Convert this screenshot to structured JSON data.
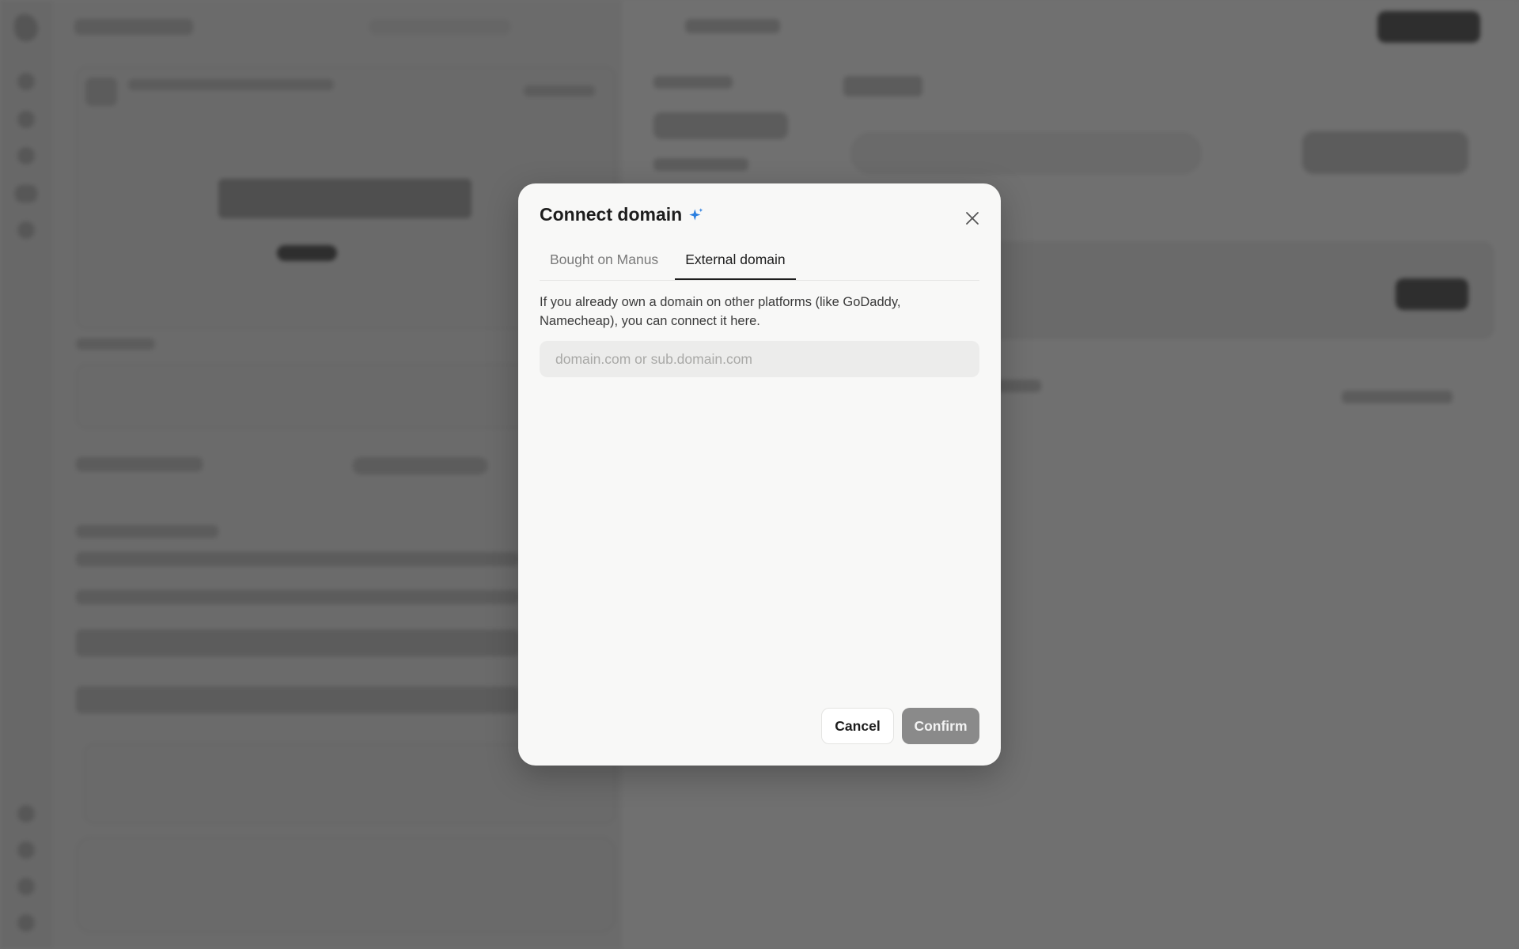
{
  "modal": {
    "title": "Connect domain",
    "tabs": [
      {
        "label": "Bought on Manus",
        "active": false
      },
      {
        "label": "External domain",
        "active": true
      }
    ],
    "description": "If you already own a domain on other platforms (like GoDaddy, Namecheap), you can connect it here.",
    "input": {
      "placeholder": "domain.com or sub.domain.com",
      "value": ""
    },
    "cancel_label": "Cancel",
    "confirm_label": "Confirm"
  },
  "colors": {
    "overlay": "#6e6e6e",
    "modal_bg": "#f8f8f7",
    "sparkle": "#2b7fe0",
    "confirm_bg": "#8a8a8a"
  },
  "icons": {
    "title_icon": "sparkle-icon",
    "close": "close-icon"
  }
}
